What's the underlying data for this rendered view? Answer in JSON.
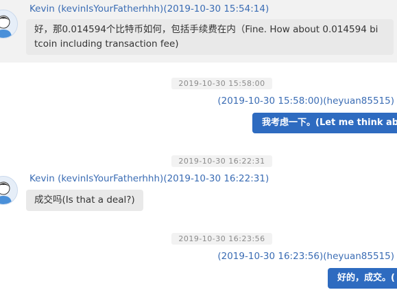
{
  "messages": [
    {
      "sender": "Kevin (kevinIsYourFatherhhh)(2019-10-30 15:54:14)",
      "text_line1": "好，那0.014594个比特币如何，包括手续费在内（Fine. How about 0.014594 bi",
      "text_line2": "tcoin including transaction fee)"
    },
    {
      "timestamp": "2019-10-30 15:58:00",
      "sender": "(2019-10-30 15:58:00)(heyuan85515)",
      "text": "我考虑一下。(Let me think abo"
    },
    {
      "timestamp": "2019-10-30 16:22:31",
      "sender": "Kevin (kevinIsYourFatherhhh)(2019-10-30 16:22:31)",
      "text": "成交吗(Is that a deal?)"
    },
    {
      "timestamp": "2019-10-30 16:23:56",
      "sender": "(2019-10-30 16:23:56)(heyuan85515)",
      "text": "好的，成交。("
    }
  ],
  "icons": {
    "avatar": "user-avatar-icon"
  },
  "colors": {
    "name_blue": "#3a6cb4",
    "outgoing_bubble": "#2e6bc0",
    "incoming_bubble": "#e9e9e9",
    "timestamp_bg": "#f2f2f2"
  }
}
